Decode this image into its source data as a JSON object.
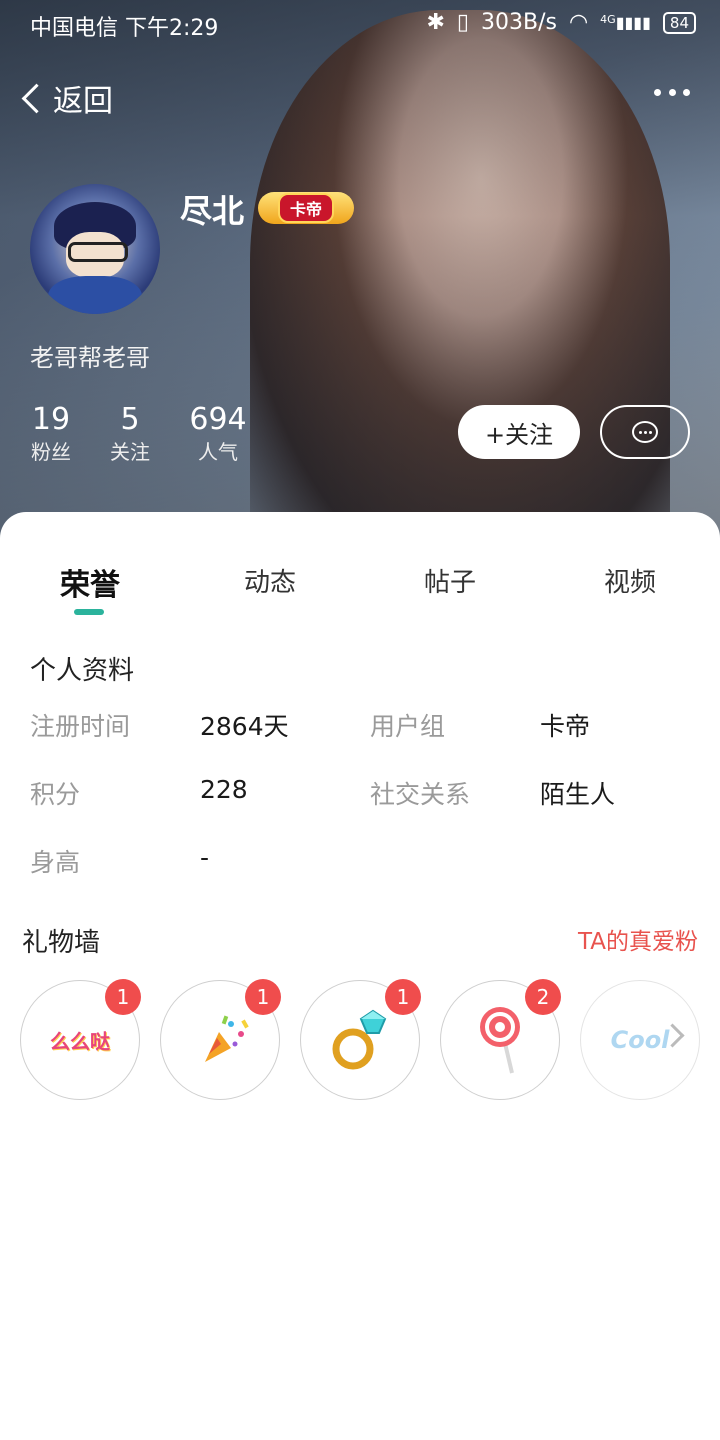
{
  "status_bar": {
    "carrier": "中国电信",
    "time": "下午2:29",
    "speed": "303B/s",
    "network": "4G",
    "battery": "84"
  },
  "nav": {
    "back_label": "返回",
    "more_icon": "more-dots-icon"
  },
  "profile": {
    "username": "尽北",
    "vip_badge": "卡帝",
    "signature": "老哥帮老哥",
    "stats": [
      {
        "value": "19",
        "label": "粉丝"
      },
      {
        "value": "5",
        "label": "关注"
      },
      {
        "value": "694",
        "label": "人气"
      }
    ],
    "follow_label": "+关注",
    "message_icon": "chat-bubble-icon"
  },
  "tabs": [
    {
      "label": "荣誉",
      "active": true
    },
    {
      "label": "动态",
      "active": false
    },
    {
      "label": "帖子",
      "active": false
    },
    {
      "label": "视频",
      "active": false
    }
  ],
  "personal_info": {
    "title": "个人资料",
    "rows": [
      {
        "label1": "注册时间",
        "value1": "2864天",
        "label2": "用户组",
        "value2": "卡帝"
      },
      {
        "label1": "积分",
        "value1": "228",
        "label2": "社交关系",
        "value2": "陌生人"
      },
      {
        "label1": "身高",
        "value1": "-"
      }
    ]
  },
  "gift_wall": {
    "title": "礼物墙",
    "link": "TA的真爱粉",
    "gifts": [
      {
        "name": "么么哒",
        "count": "1"
      },
      {
        "name": "party-popper",
        "count": "1"
      },
      {
        "name": "diamond-ring",
        "count": "1"
      },
      {
        "name": "lollipop",
        "count": "2"
      },
      {
        "name": "Cool",
        "count": ""
      }
    ]
  },
  "colors": {
    "accent": "#2bb39c",
    "badge_red": "#f04d4d",
    "link_red": "#e8534e"
  }
}
